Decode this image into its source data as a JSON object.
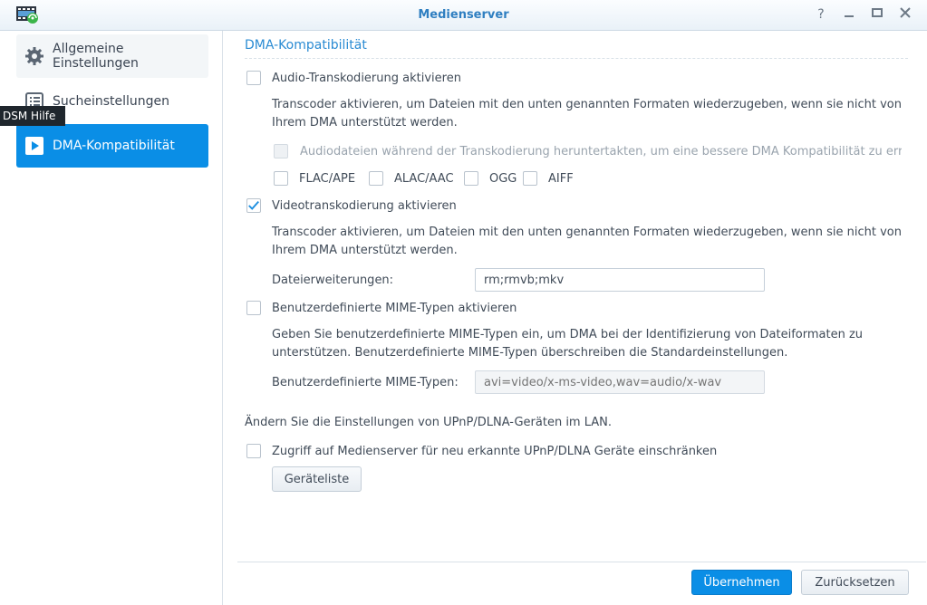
{
  "window": {
    "title": "Medienserver",
    "controls": [
      "help-icon",
      "minimize-icon",
      "maximize-icon",
      "close-icon"
    ]
  },
  "sidebar": {
    "items": [
      {
        "label": "Allgemeine Einstellungen",
        "icon": "gear-icon",
        "active": false
      },
      {
        "label": "Sucheinstellungen",
        "icon": "list-icon",
        "active": false
      },
      {
        "label": "DMA-Kompatibilität",
        "icon": "play-icon",
        "active": true
      }
    ],
    "tooltip": "DSM Hilfe"
  },
  "main": {
    "section_title": "DMA-Kompatibilität",
    "audio": {
      "checkbox_label": "Audio-Transkodierung aktivieren",
      "checked": false,
      "description": "Transcoder aktivieren, um Dateien mit den unten genannten Formaten wiederzugeben, wenn sie nicht von Ihrem DMA unterstützt werden.",
      "downsample_label": "Audiodateien während der Transkodierung heruntertakten, um eine bessere DMA Kompatibilität zu erreicl",
      "formats": [
        {
          "label": "FLAC/APE",
          "checked": false
        },
        {
          "label": "ALAC/AAC",
          "checked": false
        },
        {
          "label": "OGG",
          "checked": false
        },
        {
          "label": "AIFF",
          "checked": false
        }
      ]
    },
    "video": {
      "checkbox_label": "Videotranskodierung aktivieren",
      "checked": true,
      "description": "Transcoder aktivieren, um Dateien mit den unten genannten Formaten wiederzugeben, wenn sie nicht von Ihrem DMA unterstützt werden.",
      "ext_label": "Dateierweiterungen:",
      "ext_value": "rm;rmvb;mkv"
    },
    "mime": {
      "checkbox_label": "Benutzerdefinierte MIME-Typen aktivieren",
      "checked": false,
      "description": "Geben Sie benutzerdefinierte MIME-Typen ein, um DMA bei der Identifizierung von Dateiformaten zu unterstützen. Benutzerdefinierte MIME-Typen überschreiben die Standardeinstellungen.",
      "field_label": "Benutzerdefinierte MIME-Typen:",
      "placeholder": "avi=video/x-ms-video,wav=audio/x-wav"
    },
    "upnp": {
      "heading": "Ändern Sie die Einstellungen von UPnP/DLNA-Geräten im LAN.",
      "checkbox_label": "Zugriff auf Medienserver für neu erkannte UPnP/DLNA Geräte einschränken",
      "checked": false,
      "device_list_button": "Geräteliste"
    }
  },
  "footer": {
    "apply_label": "Übernehmen",
    "reset_label": "Zurücksetzen"
  },
  "colors": {
    "accent": "#0a8ee6",
    "title": "#2f7fc1",
    "text": "#404b58"
  }
}
